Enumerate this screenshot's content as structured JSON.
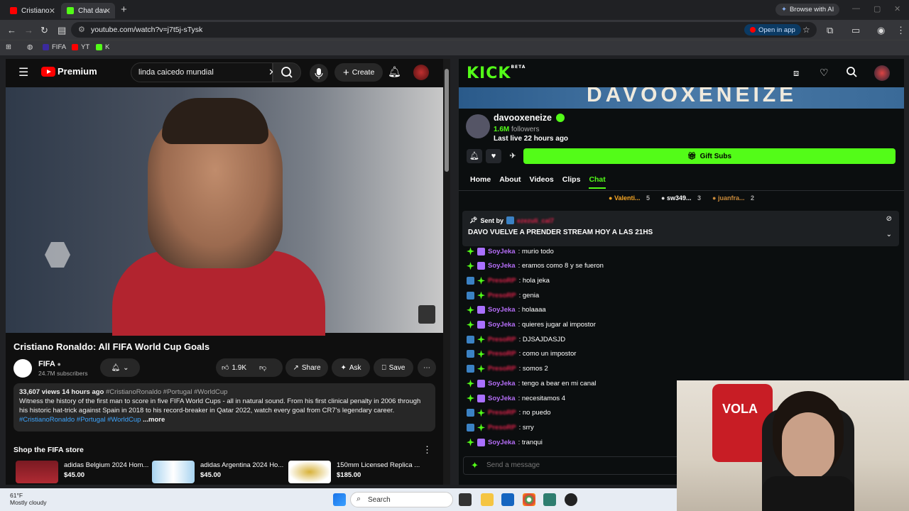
{
  "browser": {
    "tabs": [
      {
        "label": "Cristiano",
        "active": false
      },
      {
        "label": "Chat dav",
        "active": true
      }
    ],
    "browse_ai": "Browse with AI",
    "url": "youtube.com/watch?v=j7t5j-sTysk",
    "open_in_app": "Open in app",
    "bookmarks": [
      {
        "label": "FIFA"
      },
      {
        "label": "YT"
      },
      {
        "label": "K"
      }
    ]
  },
  "youtube": {
    "logo": "Premium",
    "search_value": "linda caicedo mundial",
    "create_label": "Create",
    "video_title": "Cristiano Ronaldo: All FIFA World Cup Goals",
    "channel": {
      "name": "FIFA",
      "subscribers": "24.7M subscribers"
    },
    "likes": "1.9K",
    "share_label": "Share",
    "ask_label": "Ask",
    "save_label": "Save",
    "description": {
      "meta": "33,607 views  14 hours ago",
      "tags": "#CristianoRonaldo #Portugal #WorldCup",
      "text": "Witness the history of the first man to score in five FIFA World Cups - all in natural sound. From his first clinical penalty in 2006 through his historic hat-trick against Spain in 2018 to his record-breaker in Qatar 2022, watch every goal from CR7's legendary career.",
      "tags2": "#CristianoRonaldo #Portugal #WorldCup",
      "more": "...more"
    },
    "shop_title": "Shop the FIFA store",
    "products": [
      {
        "name": "adidas Belgium 2024 Hom...",
        "price": "$45.00"
      },
      {
        "name": "adidas Argentina 2024 Ho...",
        "price": "$45.00"
      },
      {
        "name": "150mm Licensed Replica ...",
        "price": "$185.00"
      }
    ]
  },
  "kick": {
    "logo": "KICK",
    "logo_beta": "BETA",
    "banner_text": "DAVOOXENEIZE",
    "streamer": "davooxeneize",
    "followers_count": "1.6M",
    "followers_label": "followers",
    "last_live": "Last live 22 hours ago",
    "gift_subs": "Gift Subs",
    "tabs": [
      "Home",
      "About",
      "Videos",
      "Clips",
      "Chat"
    ],
    "active_tab": "Chat",
    "leaders": [
      {
        "name": "Valenti...",
        "count": "5",
        "color": "#f5a524"
      },
      {
        "name": "sw349...",
        "count": "3",
        "color": "#dddddd"
      },
      {
        "name": "juanfra...",
        "count": "2",
        "color": "#c98a3a"
      }
    ],
    "pinned": {
      "sent_by": "Sent by",
      "author": "ezezuli_cal7",
      "message": "DAVO VUELVE A PRENDER STREAM HOY A LAS 21HS"
    },
    "messages": [
      {
        "user": "SoyJeka",
        "text": ": murio todo",
        "color": "#b56ef7",
        "badge": "sub"
      },
      {
        "user": "SoyJeka",
        "text": ": eramos como 8 y se fueron",
        "color": "#b56ef7",
        "badge": "sub"
      },
      {
        "user": "PresoRP",
        "text": ": hola jeka",
        "color": "#e0244c",
        "badge": "verified"
      },
      {
        "user": "PresoRP",
        "text": ": genia",
        "color": "#e0244c",
        "badge": "verified"
      },
      {
        "user": "SoyJeka",
        "text": ": holaaaa",
        "color": "#b56ef7",
        "badge": "sub"
      },
      {
        "user": "SoyJeka",
        "text": ": quieres jugar al impostor",
        "color": "#b56ef7",
        "badge": "sub"
      },
      {
        "user": "PresoRP",
        "text": ": DJSAJDASJD",
        "color": "#e0244c",
        "badge": "verified"
      },
      {
        "user": "PresoRP",
        "text": ": como un impostor",
        "color": "#e0244c",
        "badge": "verified"
      },
      {
        "user": "PresoRP",
        "text": ": somos 2",
        "color": "#e0244c",
        "badge": "verified"
      },
      {
        "user": "SoyJeka",
        "text": ": tengo a bear en mi canal",
        "color": "#b56ef7",
        "badge": "sub"
      },
      {
        "user": "SoyJeka",
        "text": ": necesitamos 4",
        "color": "#b56ef7",
        "badge": "sub"
      },
      {
        "user": "PresoRP",
        "text": ": no puedo",
        "color": "#e0244c",
        "badge": "verified"
      },
      {
        "user": "PresoRP",
        "text": ": srry",
        "color": "#e0244c",
        "badge": "verified"
      },
      {
        "user": "SoyJeka",
        "text": ": tranqui",
        "color": "#b56ef7",
        "badge": "sub"
      }
    ],
    "send_placeholder": "Send a message"
  },
  "webcam": {
    "shirt_text": "VOLA"
  },
  "taskbar": {
    "temp": "61°F",
    "weather": "Mostly cloudy",
    "search": "Search"
  },
  "colors": {
    "kick_green": "#53fc18",
    "yt_red": "#ff0000"
  }
}
